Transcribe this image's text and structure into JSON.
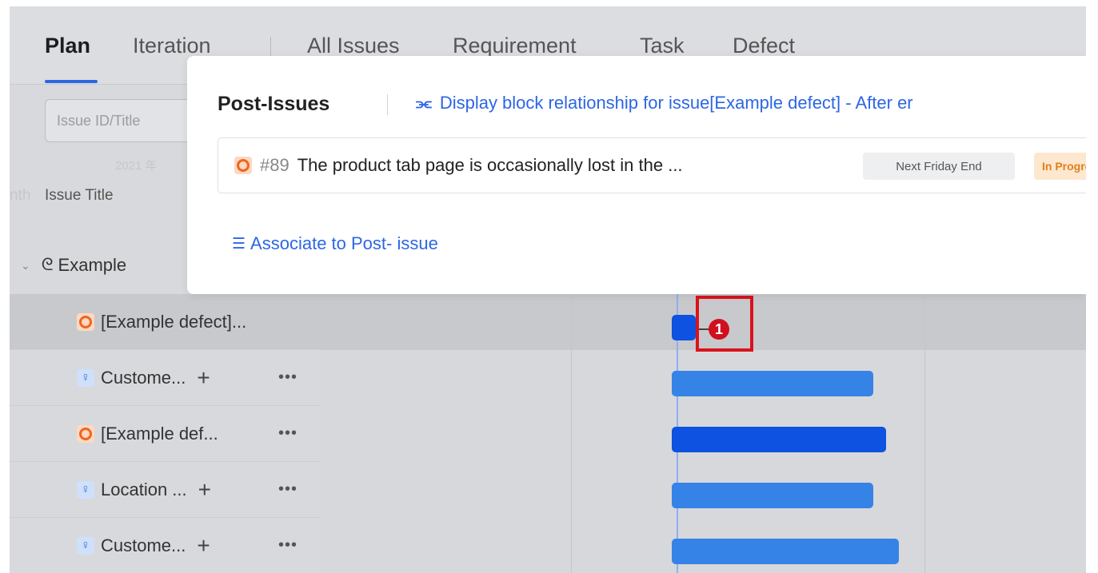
{
  "tabs": [
    {
      "label": "Plan",
      "active": true
    },
    {
      "label": "Iteration",
      "active": false
    },
    {
      "label": "All Issues",
      "active": false
    },
    {
      "label": "Requirement",
      "active": false
    },
    {
      "label": "Task",
      "active": false
    },
    {
      "label": "Defect",
      "active": false
    }
  ],
  "search": {
    "placeholder": "Issue ID/Title"
  },
  "faint_date": "2021 年",
  "column_header": "Issue Title",
  "column_header_shadow": "nth",
  "group": {
    "label": "Example",
    "icon": "iteration-icon"
  },
  "rows": [
    {
      "label": "[Example defect]...",
      "type": "defect",
      "icon": "defect-icon",
      "has_add": false,
      "has_more": false
    },
    {
      "label": "Custome...",
      "type": "requirement",
      "icon": "requirement-icon",
      "has_add": true,
      "has_more": true
    },
    {
      "label": "[Example def...",
      "type": "defect",
      "icon": "defect-icon",
      "has_add": false,
      "has_more": true
    },
    {
      "label": "Location ...",
      "type": "requirement",
      "icon": "requirement-icon",
      "has_add": true,
      "has_more": true
    },
    {
      "label": "Custome...",
      "type": "requirement",
      "icon": "requirement-icon",
      "has_add": true,
      "has_more": true
    }
  ],
  "row_add_glyph": "+",
  "row_more_glyph": "•••",
  "gantt": {
    "badge_count": "1"
  },
  "popover": {
    "title": "Post-Issues",
    "link_text": "Display block relationship for issue[Example defect] - After er",
    "link_icon": "relationship-icon",
    "issue": {
      "number": "#89",
      "title": "The product tab page is occasionally lost in the ...",
      "date_tag": "Next Friday End",
      "status_tag": "In Progre"
    },
    "associate_text": "Associate to Post- issue",
    "associate_icon": "associate-search-icon"
  },
  "colors": {
    "accent": "#2c66e4",
    "defect": "#f0661f",
    "bar_light": "#3583e6",
    "bar_dark": "#0d52e0",
    "highlight": "#d9131c"
  }
}
